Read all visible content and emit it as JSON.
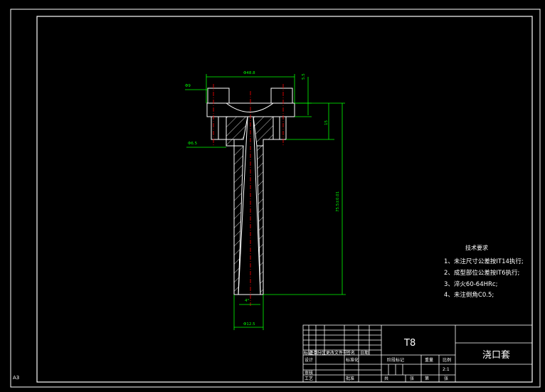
{
  "sheet": {
    "size_label": "A3",
    "colors": {
      "background": "#000000",
      "outline": "#ffffff",
      "dimension": "#00ff00",
      "centerline": "#ff0000"
    }
  },
  "dimensions": {
    "head_diameter": "Φ48.8",
    "head_thickness": "5.5",
    "counterbore_diameter": "Φ9",
    "flange_height": "15",
    "step_diameter": "Φ6.5",
    "overall_length": "75.5±0.01",
    "taper_angle": "4°",
    "shank_diameter": "Φ12.5"
  },
  "technical_requirements": {
    "title": "技术要求",
    "items": [
      "1、未注尺寸公差按IT14执行;",
      "2、成型部位公差按IT6执行;",
      "3、淬火60-64HRc;",
      "4、未注倒角C0.5;"
    ]
  },
  "title_block": {
    "material": "T8",
    "part_name": "浇口套",
    "scale": "2:1",
    "labels": {
      "mark": "标记",
      "count": "处数",
      "zone": "分区",
      "change_doc": "更改文件号",
      "signature": "签名",
      "date": "日期",
      "design": "设计",
      "standardize": "标准化",
      "stage_mark": "阶段标记",
      "weight": "重量",
      "scale": "比例",
      "review": "审核",
      "process": "工艺",
      "approve": "批准",
      "total": "共",
      "sheet_word": "张",
      "of": "第"
    }
  }
}
